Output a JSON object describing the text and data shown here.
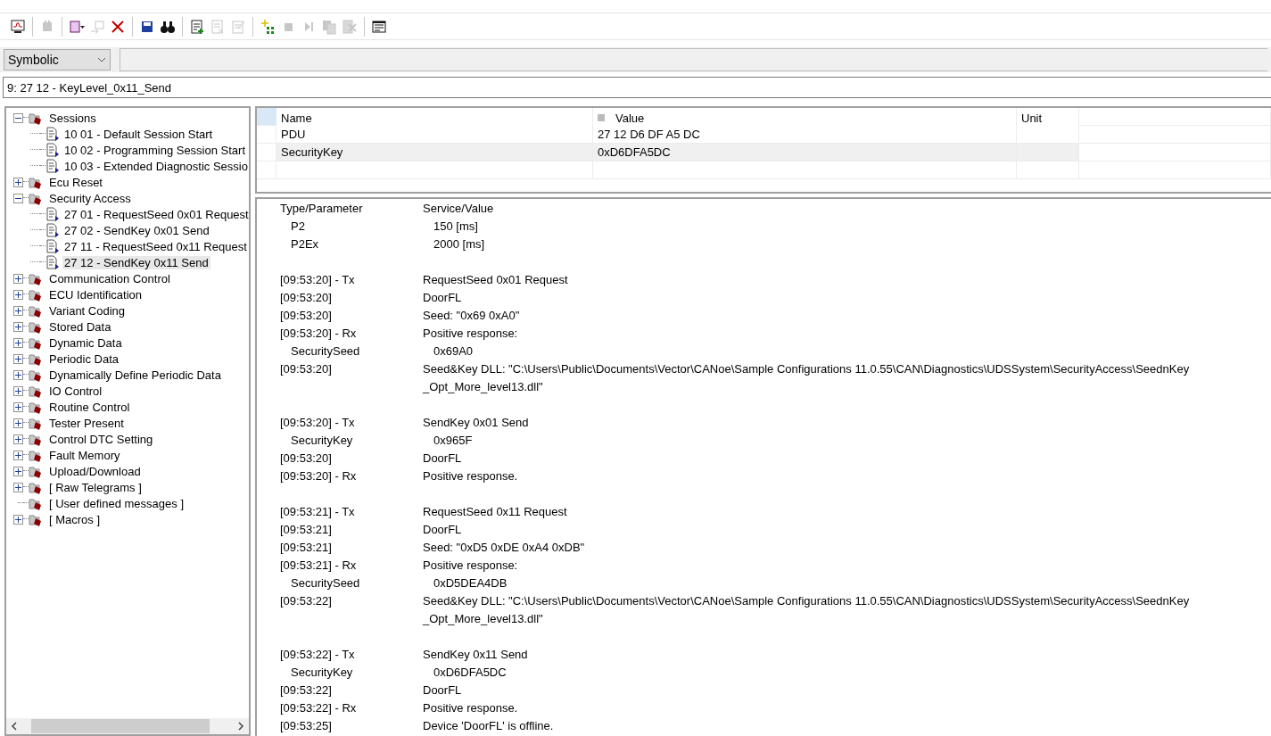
{
  "toolbar": [
    {
      "kind": "monitor",
      "disabled": false
    },
    {
      "kind": "sep"
    },
    {
      "kind": "plug",
      "disabled": true
    },
    {
      "kind": "sep"
    },
    {
      "kind": "book",
      "disabled": false
    },
    {
      "kind": "swap",
      "disabled": true
    },
    {
      "kind": "delete",
      "disabled": false
    },
    {
      "kind": "sep"
    },
    {
      "kind": "save",
      "disabled": false
    },
    {
      "kind": "binoculars",
      "disabled": false
    },
    {
      "kind": "sep"
    },
    {
      "kind": "doc-add",
      "disabled": false
    },
    {
      "kind": "doc-remove",
      "disabled": true
    },
    {
      "kind": "doc-edit",
      "disabled": true
    },
    {
      "kind": "sep"
    },
    {
      "kind": "sparkle",
      "disabled": false
    },
    {
      "kind": "stop",
      "disabled": true
    },
    {
      "kind": "step",
      "disabled": true
    },
    {
      "kind": "copy",
      "disabled": true
    },
    {
      "kind": "clear",
      "disabled": true
    },
    {
      "kind": "sep"
    },
    {
      "kind": "notes",
      "disabled": false
    }
  ],
  "mode_select": {
    "value": "Symbolic"
  },
  "request_field": {
    "value": "9: 27 12 - KeyLevel_0x11_Send"
  },
  "tree": [
    {
      "label": "Sessions",
      "kind": "folder",
      "expanded": true,
      "selected": false,
      "children": [
        {
          "label": "10 01 - Default Session Start",
          "kind": "service",
          "selected": false
        },
        {
          "label": "10 02 - Programming Session Start",
          "kind": "service",
          "selected": false
        },
        {
          "label": "10 03 - Extended Diagnostic Sessio",
          "kind": "service",
          "selected": false
        }
      ]
    },
    {
      "label": "Ecu Reset",
      "kind": "folder",
      "expanded": false,
      "selected": false
    },
    {
      "label": "Security Access",
      "kind": "folder",
      "expanded": true,
      "selected": false,
      "children": [
        {
          "label": "27 01 - RequestSeed 0x01 Request",
          "kind": "service",
          "selected": false
        },
        {
          "label": "27 02 - SendKey 0x01 Send",
          "kind": "service",
          "selected": false
        },
        {
          "label": "27 11 - RequestSeed 0x11 Request",
          "kind": "service",
          "selected": false
        },
        {
          "label": "27 12 - SendKey 0x11 Send",
          "kind": "service",
          "selected": true
        }
      ]
    },
    {
      "label": "Communication Control",
      "kind": "folder",
      "expanded": false,
      "selected": false
    },
    {
      "label": "ECU Identification",
      "kind": "folder",
      "expanded": false,
      "selected": false
    },
    {
      "label": "Variant Coding",
      "kind": "folder",
      "expanded": false,
      "selected": false
    },
    {
      "label": "Stored Data",
      "kind": "folder",
      "expanded": false,
      "selected": false
    },
    {
      "label": "Dynamic Data",
      "kind": "folder",
      "expanded": false,
      "selected": false
    },
    {
      "label": "Periodic Data",
      "kind": "folder",
      "expanded": false,
      "selected": false
    },
    {
      "label": "Dynamically Define Periodic Data",
      "kind": "folder",
      "expanded": false,
      "selected": false
    },
    {
      "label": "IO Control",
      "kind": "folder",
      "expanded": false,
      "selected": false
    },
    {
      "label": "Routine Control",
      "kind": "folder",
      "expanded": false,
      "selected": false
    },
    {
      "label": "Tester Present",
      "kind": "folder",
      "expanded": false,
      "selected": false
    },
    {
      "label": "Control DTC Setting",
      "kind": "folder",
      "expanded": false,
      "selected": false
    },
    {
      "label": "Fault Memory",
      "kind": "folder",
      "expanded": false,
      "selected": false
    },
    {
      "label": "Upload/Download",
      "kind": "folder",
      "expanded": false,
      "selected": false
    },
    {
      "label": "[ Raw Telegrams ]",
      "kind": "folder",
      "expanded": false,
      "selected": false
    },
    {
      "label": "[ User defined messages ]",
      "kind": "leaf-folder",
      "selected": false
    },
    {
      "label": "[ Macros ]",
      "kind": "folder",
      "expanded": false,
      "selected": false
    }
  ],
  "parameter_table": {
    "columns": [
      "Name",
      "Value",
      "Unit"
    ],
    "rows": [
      {
        "name": "PDU",
        "value": "27 12 D6 DF A5 DC",
        "selected": false
      },
      {
        "name": "SecurityKey",
        "value": "0xD6DFA5DC",
        "selected": true
      }
    ]
  },
  "log": {
    "columns": [
      "Type/Parameter",
      "Service/Value"
    ],
    "rows": [
      {
        "kind": "param",
        "label": "P2",
        "value": "150 [ms]"
      },
      {
        "kind": "param",
        "label": "P2Ex",
        "value": "2000 [ms]"
      },
      {
        "kind": "gap"
      },
      {
        "kind": "entry",
        "label": "[09:53:20] - Tx",
        "value": "RequestSeed 0x01 Request"
      },
      {
        "kind": "entry",
        "label": "[09:53:20]",
        "value": "DoorFL"
      },
      {
        "kind": "entry",
        "label": "[09:53:20]",
        "value": "Seed: \"0x69 0xA0\""
      },
      {
        "kind": "entry",
        "label": "[09:53:20] - Rx",
        "value": "Positive response:"
      },
      {
        "kind": "param",
        "label": "SecuritySeed",
        "value": "0x69A0"
      },
      {
        "kind": "entry",
        "label": "[09:53:20]",
        "value": "Seed&Key DLL: \"C:\\Users\\Public\\Documents\\Vector\\CANoe\\Sample Configurations 11.0.55\\CAN\\Diagnostics\\UDSSystem\\SecurityAccess\\SeednKey",
        "more": "_Opt_More_level13.dll\""
      },
      {
        "kind": "gap"
      },
      {
        "kind": "entry",
        "label": "[09:53:20] - Tx",
        "value": "SendKey 0x01 Send"
      },
      {
        "kind": "param",
        "label": "SecurityKey",
        "value": "0x965F"
      },
      {
        "kind": "entry",
        "label": "[09:53:20]",
        "value": "DoorFL"
      },
      {
        "kind": "entry",
        "label": "[09:53:20] - Rx",
        "value": "Positive response."
      },
      {
        "kind": "gap"
      },
      {
        "kind": "entry",
        "label": "[09:53:21] - Tx",
        "value": "RequestSeed 0x11 Request"
      },
      {
        "kind": "entry",
        "label": "[09:53:21]",
        "value": "DoorFL"
      },
      {
        "kind": "entry",
        "label": "[09:53:21]",
        "value": "Seed: \"0xD5 0xDE 0xA4 0xDB\""
      },
      {
        "kind": "entry",
        "label": "[09:53:21] - Rx",
        "value": "Positive response:"
      },
      {
        "kind": "param",
        "label": "SecuritySeed",
        "value": "0xD5DEA4DB"
      },
      {
        "kind": "entry",
        "label": "[09:53:22]",
        "value": "Seed&Key DLL: \"C:\\Users\\Public\\Documents\\Vector\\CANoe\\Sample Configurations 11.0.55\\CAN\\Diagnostics\\UDSSystem\\SecurityAccess\\SeednKey",
        "more": "_Opt_More_level13.dll\""
      },
      {
        "kind": "gap"
      },
      {
        "kind": "entry",
        "label": "[09:53:22] - Tx",
        "value": "SendKey 0x11 Send"
      },
      {
        "kind": "param",
        "label": "SecurityKey",
        "value": "0xD6DFA5DC"
      },
      {
        "kind": "entry",
        "label": "[09:53:22]",
        "value": "DoorFL"
      },
      {
        "kind": "entry",
        "label": "[09:53:22] - Rx",
        "value": "Positive response."
      },
      {
        "kind": "entry",
        "label": "[09:53:25]",
        "value": "Device 'DoorFL' is offline."
      }
    ]
  }
}
